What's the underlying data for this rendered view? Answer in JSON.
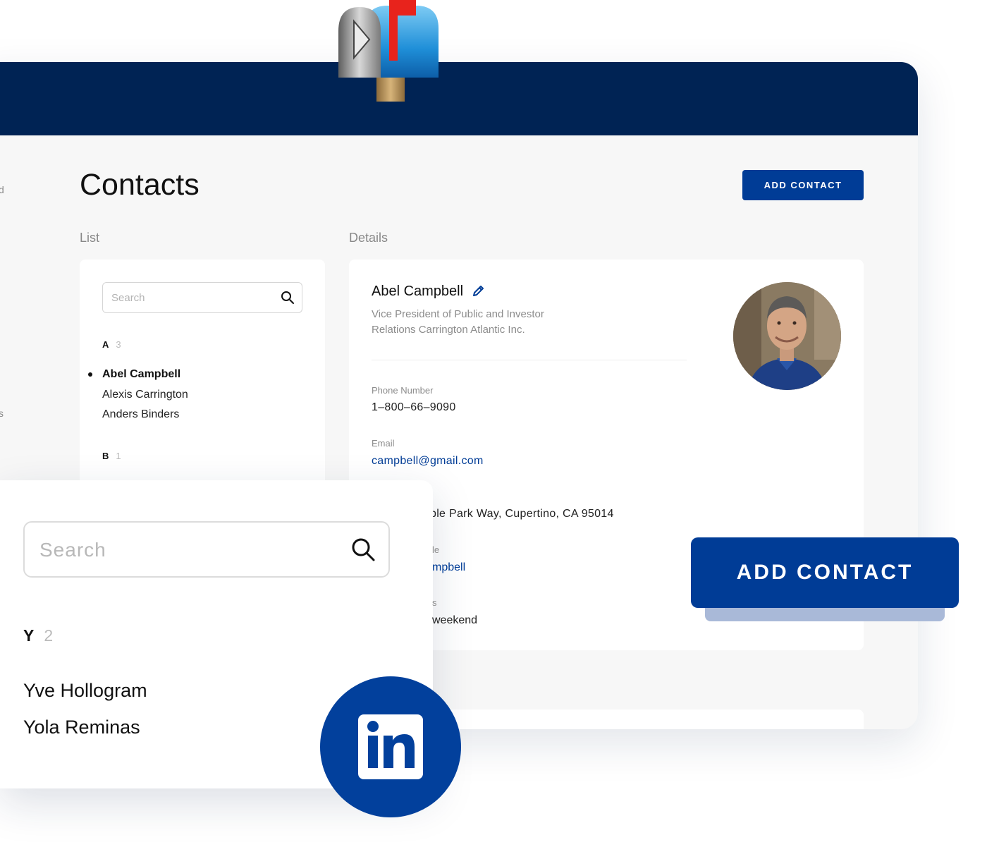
{
  "page": {
    "title": "Contacts",
    "add_contact_label": "ADD CONTACT",
    "list_label": "List",
    "details_label": "Details",
    "sidebar_fragments": [
      "d",
      "s"
    ]
  },
  "list": {
    "search_placeholder": "Search",
    "groups": [
      {
        "letter": "A",
        "count": "3",
        "items": [
          "Abel Campbell",
          "Alexis Carrington",
          "Anders Binders"
        ]
      },
      {
        "letter": "B",
        "count": "1",
        "items": []
      }
    ],
    "selected": "Abel Campbell"
  },
  "details": {
    "name": "Abel Campbell",
    "title": "Vice President of Public and Investor Relations Carrington Atlantic Inc.",
    "phone_label": "Phone Number",
    "phone": "1–800–66–9090",
    "email_label": "Email",
    "email": "campbell@gmail.com",
    "address_partial": "ple Park Way, Cupertino, CA 95014",
    "profile_label_partial": "le",
    "profile_partial": "mpbell",
    "note_label_partial": "s",
    "note_partial": "weekend"
  },
  "overlay": {
    "search_placeholder": "Search",
    "letter": "Y",
    "count": "2",
    "items": [
      "Yve Hollogram",
      "Yola Reminas"
    ]
  },
  "floating": {
    "add_contact_label": "ADD CONTACT",
    "linkedin_icon": "linkedin-icon",
    "mailbox_icon": "mailbox-icon"
  },
  "colors": {
    "navy": "#002354",
    "brand_blue": "#003c96",
    "linkedin_blue": "#02409c",
    "background": "#f7f7f7"
  }
}
